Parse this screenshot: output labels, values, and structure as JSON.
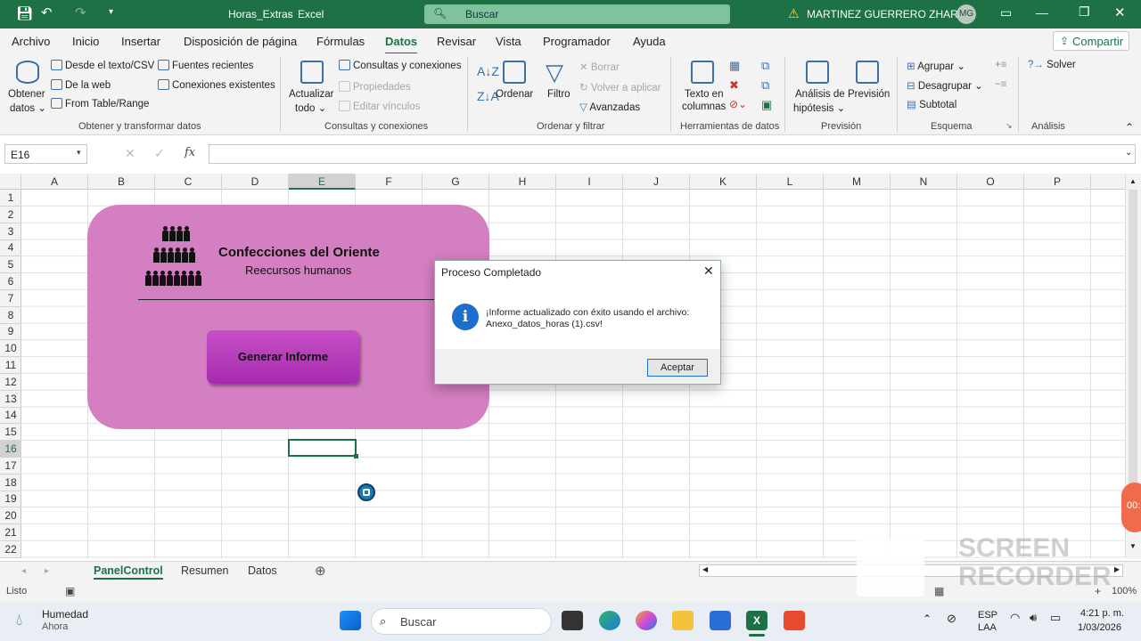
{
  "window": {
    "file_title": "Horas_Extras",
    "app_name": "Excel",
    "separator": "-",
    "search_placeholder": "Buscar",
    "user_name": "MARTINEZ GUERRERO ZHARIKT",
    "user_initials": "MG"
  },
  "ribbon_tabs": [
    "Archivo",
    "Inicio",
    "Insertar",
    "Disposición de página",
    "Fórmulas",
    "Datos",
    "Revisar",
    "Vista",
    "Programador",
    "Ayuda"
  ],
  "active_tab": "Datos",
  "share_label": "Compartir",
  "ribbon": {
    "obtener_datos": {
      "line1": "Obtener",
      "line2": "datos ⌄"
    },
    "desde_texto": "Desde el texto/CSV",
    "de_la_web": "De la web",
    "from_table": "From Table/Range",
    "fuentes_recientes": "Fuentes recientes",
    "conexiones_existentes": "Conexiones existentes",
    "group_obtener": "Obtener y transformar datos",
    "actualizar": {
      "line1": "Actualizar",
      "line2": "todo ⌄"
    },
    "consultas_conexiones": "Consultas y conexiones",
    "propiedades": "Propiedades",
    "editar_vinculos": "Editar vínculos",
    "group_consultas": "Consultas y conexiones",
    "ordenar": "Ordenar",
    "filtro": "Filtro",
    "borrar": "Borrar",
    "volver_aplicar": "Volver a aplicar",
    "avanzadas": "Avanzadas",
    "group_ordenar": "Ordenar y filtrar",
    "texto_columnas": {
      "line1": "Texto en",
      "line2": "columnas"
    },
    "group_herramientas": "Herramientas de datos",
    "analisis_hipotesis": {
      "line1": "Análisis de",
      "line2": "hipótesis ⌄"
    },
    "prevision": "Previsión",
    "group_prevision": "Previsión",
    "agrupar": "Agrupar",
    "desagrupar": "Desagrupar",
    "subtotal": "Subtotal",
    "group_esquema": "Esquema",
    "solver": "Solver",
    "group_analisis": "Análisis"
  },
  "name_box": "E16",
  "formula_bar_value": "",
  "columns": [
    "A",
    "B",
    "C",
    "D",
    "E",
    "F",
    "G",
    "H",
    "I",
    "J",
    "K",
    "L",
    "M",
    "N",
    "O",
    "P"
  ],
  "selected_column": "E",
  "rows": [
    "1",
    "2",
    "3",
    "4",
    "5",
    "6",
    "7",
    "8",
    "9",
    "10",
    "11",
    "12",
    "13",
    "14",
    "15",
    "16",
    "17",
    "18",
    "19",
    "20",
    "21",
    "22"
  ],
  "selected_row": "16",
  "panel": {
    "company": "Confecciones del Oriente",
    "department": "Reecursos humanos",
    "button_label": "Generar Informe"
  },
  "dialog": {
    "title": "Proceso Completado",
    "message_line1": "¡Informe actualizado con éxito usando el archivo:",
    "message_line2": "Anexo_datos_horas (1).csv!",
    "ok_label": "Aceptar",
    "close_symbol": "✕",
    "info_symbol": "i"
  },
  "sheets": [
    "PanelControl",
    "Resumen",
    "Datos"
  ],
  "active_sheet": "PanelControl",
  "status": {
    "ready": "Listo",
    "zoom": "100%"
  },
  "taskbar": {
    "weather_title": "Humedad",
    "weather_sub": "Ahora",
    "search": "Buscar",
    "lang1": "ESP",
    "lang2": "LAA",
    "time": "4:21 p. m.",
    "date": "1/03/2026"
  },
  "watermark": {
    "line1": "SCREEN",
    "line2": "RECORDER"
  },
  "recorder_badge": "00:"
}
